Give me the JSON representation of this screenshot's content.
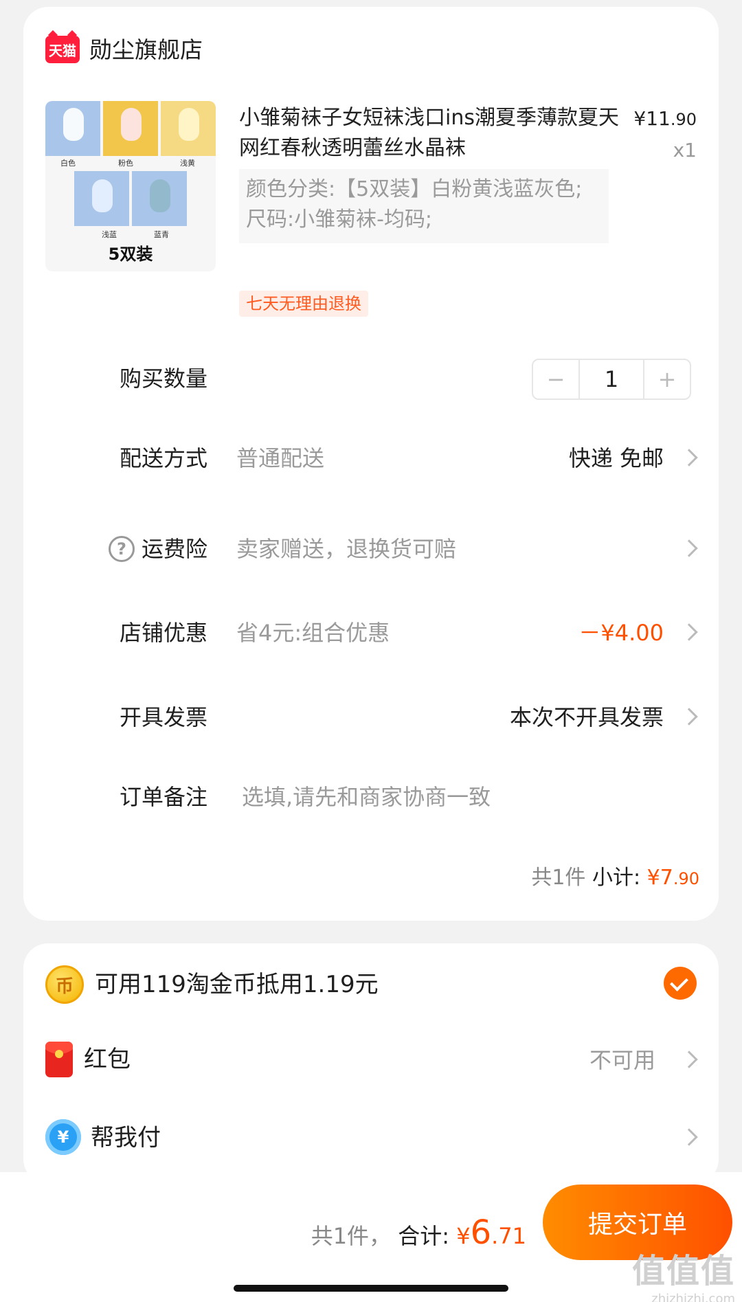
{
  "store": {
    "logo_text": "天猫",
    "name": "勋尘旗舰店"
  },
  "product": {
    "title": "小雏菊袜子女短袜浅口ins潮夏季薄款夏天网红春秋透明蕾丝水晶袜",
    "price_symbol": "¥",
    "price_int": "11",
    "price_dec": ".90",
    "quantity_text": "x1",
    "spec_line1": "颜色分类:【5双装】白粉黄浅蓝灰色;",
    "spec_line2": "尺码:小雏菊袜-均码;",
    "tag": "七天无理由退换",
    "thumb": {
      "swatches": [
        "白色",
        "粉色",
        "浅黄",
        "浅蓝",
        "蓝青"
      ],
      "pack_label": "5双装"
    }
  },
  "rows": {
    "quantity": {
      "label": "购买数量",
      "value": "1",
      "minus": "−",
      "plus": "+"
    },
    "shipping": {
      "label": "配送方式",
      "desc": "普通配送",
      "right": "快递 免邮"
    },
    "insurance": {
      "label": "运费险",
      "desc": "卖家赠送，退换货可赔",
      "icon": "?"
    },
    "discount": {
      "label": "店铺优惠",
      "desc": "省4元:组合优惠",
      "right": "－¥4.00"
    },
    "invoice": {
      "label": "开具发票",
      "right": "本次不开具发票"
    },
    "note": {
      "label": "订单备注",
      "placeholder": "选填,请先和商家协商一致"
    }
  },
  "subtotal": {
    "count": "共1件",
    "label": "小计:",
    "symbol": "¥",
    "int": "7",
    "dec": ".90"
  },
  "payments": {
    "coins": {
      "label": "可用119淘金币抵用1.19元",
      "icon_text": "币"
    },
    "redpacket": {
      "label": "红包",
      "status": "不可用"
    },
    "helppay": {
      "label": "帮我付",
      "icon_text": "¥"
    }
  },
  "footer": {
    "count": "共1件，",
    "total_label": "合计:",
    "symbol": "¥",
    "int": "6",
    "dec": ".71",
    "submit": "提交订单",
    "watermark": "值值值",
    "watermark_url": "zhizhizhi.com"
  },
  "colors": {
    "accent": "#ff5000",
    "tmall": "#ff1e3c"
  }
}
